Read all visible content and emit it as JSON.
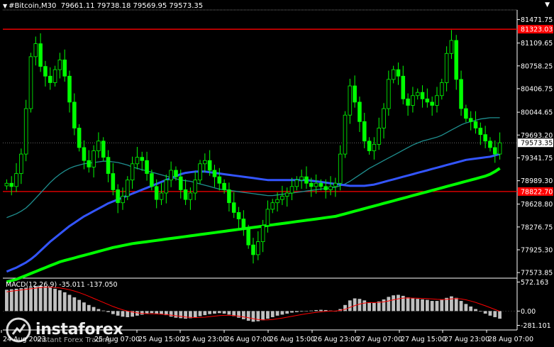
{
  "header": {
    "symbol": "#Bitcoin,M30",
    "quote": "79661.11 79738.18 79569.95 79573.35"
  },
  "indicator": {
    "label": "MACD(12,26,9) -35.011 -137.050"
  },
  "watermark": {
    "name": "instaforex",
    "sub": "Instant Forex Trading"
  },
  "colors": {
    "background": "#000000",
    "candle": "#00ff00",
    "ma_fast": "#1f8f8f",
    "ma_mid": "#3355ff",
    "ma_slow": "#00ff00",
    "level_line": "#ff0000",
    "macd_hist": "#c0c0c0",
    "macd_signal": "#ff0000"
  },
  "chart_data": {
    "type": "candlestick",
    "y_ticks": [
      "81471.75",
      "81109.65",
      "80758.25",
      "80406.75",
      "80044.65",
      "79693.20",
      "79341.75",
      "78989.30",
      "78628.80",
      "78276.75",
      "77925.30",
      "77573.85"
    ],
    "ylim": [
      77510,
      81620
    ],
    "price_labels": [
      {
        "text": "81323.03",
        "value": 81323.03,
        "type": "level",
        "color": "#ff0000"
      },
      {
        "text": "79573.35",
        "value": 79573.35,
        "type": "last",
        "color": "#ffffff"
      },
      {
        "text": "78822.70",
        "value": 78822.7,
        "type": "level",
        "color": "#ff0000"
      }
    ],
    "x_ticks": [
      "24 Aug 2023",
      "25 Aug 07:00",
      "25 Aug 15:00",
      "25 Aug 23:00",
      "26 Aug 07:00",
      "26 Aug 15:00",
      "26 Aug 23:00",
      "27 Aug 07:00",
      "27 Aug 15:00",
      "27 Aug 23:00",
      "28 Aug 07:00"
    ],
    "close": [
      78950,
      78900,
      79100,
      79400,
      80100,
      80900,
      81100,
      80750,
      80600,
      80500,
      80700,
      80850,
      80600,
      80200,
      79800,
      79500,
      79300,
      79200,
      79450,
      79600,
      79350,
      79100,
      78850,
      78650,
      78750,
      79000,
      79250,
      79350,
      79300,
      79100,
      78900,
      78700,
      78800,
      79000,
      79150,
      79050,
      78850,
      78700,
      78800,
      79000,
      79250,
      79300,
      79150,
      79050,
      78950,
      78850,
      78650,
      78500,
      78400,
      78250,
      78000,
      77850,
      78050,
      78300,
      78550,
      78650,
      78700,
      78750,
      78800,
      78900,
      79000,
      79050,
      78950,
      78900,
      78950,
      78900,
      78850,
      78900,
      78950,
      79400,
      80000,
      80450,
      80200,
      79900,
      79600,
      79450,
      79550,
      79800,
      80100,
      80550,
      80700,
      80600,
      80250,
      80150,
      80300,
      80350,
      80250,
      80200,
      80150,
      80300,
      80500,
      80950,
      81150,
      80550,
      80100,
      79950,
      79900,
      79800,
      79700,
      79600,
      79500,
      79400,
      79573.35
    ],
    "ma_fast": [
      78420,
      78450,
      78480,
      78520,
      78570,
      78640,
      78720,
      78800,
      78880,
      78960,
      79030,
      79090,
      79140,
      79180,
      79210,
      79230,
      79250,
      79260,
      79270,
      79280,
      79290,
      79290,
      79280,
      79270,
      79250,
      79230,
      79200,
      79180,
      79160,
      79140,
      79120,
      79100,
      79080,
      79060,
      79040,
      79020,
      79000,
      78990,
      78980,
      78960,
      78940,
      78920,
      78900,
      78880,
      78860,
      78850,
      78840,
      78830,
      78820,
      78810,
      78800,
      78790,
      78780,
      78770,
      78760,
      78760,
      78770,
      78780,
      78790,
      78800,
      78810,
      78820,
      78830,
      78840,
      78850,
      78860,
      78870,
      78880,
      78890,
      78910,
      78940,
      78980,
      79030,
      79080,
      79130,
      79180,
      79220,
      79260,
      79300,
      79340,
      79380,
      79420,
      79460,
      79500,
      79540,
      79570,
      79600,
      79620,
      79640,
      79660,
      79690,
      79730,
      79770,
      79810,
      79850,
      79880,
      79900,
      79920,
      79940,
      79950,
      79960,
      79960,
      79960
    ],
    "ma_mid": [
      77590,
      77620,
      77650,
      77690,
      77730,
      77780,
      77840,
      77910,
      77980,
      78050,
      78110,
      78170,
      78230,
      78290,
      78340,
      78390,
      78440,
      78480,
      78520,
      78560,
      78600,
      78640,
      78670,
      78700,
      78730,
      78760,
      78790,
      78820,
      78850,
      78880,
      78910,
      78940,
      78970,
      79000,
      79030,
      79060,
      79090,
      79110,
      79120,
      79130,
      79130,
      79130,
      79120,
      79110,
      79100,
      79090,
      79080,
      79070,
      79060,
      79050,
      79040,
      79030,
      79020,
      79010,
      79000,
      79000,
      79000,
      79000,
      79000,
      79000,
      79000,
      79000,
      79000,
      78990,
      78980,
      78970,
      78960,
      78950,
      78940,
      78930,
      78920,
      78910,
      78910,
      78910,
      78910,
      78920,
      78930,
      78950,
      78970,
      78990,
      79010,
      79030,
      79050,
      79070,
      79090,
      79110,
      79130,
      79150,
      79170,
      79190,
      79210,
      79230,
      79250,
      79270,
      79290,
      79310,
      79320,
      79330,
      79340,
      79350,
      79360,
      79380,
      79400
    ],
    "ma_slow": [
      77430,
      77450,
      77470,
      77500,
      77530,
      77560,
      77590,
      77620,
      77650,
      77680,
      77710,
      77740,
      77760,
      77780,
      77800,
      77820,
      77840,
      77860,
      77880,
      77900,
      77920,
      77940,
      77960,
      77975,
      77990,
      78005,
      78020,
      78030,
      78040,
      78050,
      78060,
      78070,
      78080,
      78090,
      78100,
      78110,
      78120,
      78130,
      78140,
      78150,
      78160,
      78170,
      78180,
      78190,
      78200,
      78210,
      78220,
      78230,
      78240,
      78250,
      78260,
      78270,
      78280,
      78290,
      78300,
      78310,
      78320,
      78330,
      78340,
      78350,
      78360,
      78370,
      78380,
      78390,
      78400,
      78410,
      78420,
      78430,
      78440,
      78460,
      78480,
      78500,
      78520,
      78540,
      78560,
      78580,
      78600,
      78620,
      78640,
      78660,
      78680,
      78700,
      78720,
      78740,
      78760,
      78780,
      78800,
      78820,
      78840,
      78860,
      78880,
      78900,
      78920,
      78940,
      78960,
      78980,
      79000,
      79020,
      79040,
      79060,
      79090,
      79130,
      79180
    ],
    "macd": {
      "y_ticks": [
        "572.163",
        "0.00",
        "-281.101"
      ],
      "ylim": [
        -330,
        620
      ],
      "hist": [
        420,
        430,
        440,
        450,
        460,
        470,
        490,
        500,
        490,
        470,
        440,
        410,
        370,
        320,
        270,
        220,
        170,
        120,
        80,
        40,
        10,
        -20,
        -60,
        -90,
        -110,
        -120,
        -110,
        -90,
        -70,
        -50,
        -40,
        -50,
        -60,
        -80,
        -110,
        -130,
        -140,
        -150,
        -140,
        -120,
        -100,
        -80,
        -60,
        -50,
        -40,
        -50,
        -70,
        -100,
        -130,
        -160,
        -190,
        -210,
        -200,
        -180,
        -150,
        -120,
        -90,
        -70,
        -50,
        -30,
        -20,
        -10,
        0,
        10,
        20,
        25,
        20,
        10,
        0,
        40,
        120,
        210,
        250,
        240,
        210,
        170,
        160,
        190,
        230,
        280,
        310,
        320,
        300,
        270,
        250,
        240,
        230,
        220,
        200,
        200,
        220,
        260,
        290,
        260,
        200,
        140,
        90,
        40,
        -10,
        -50,
        -90,
        -120,
        -150
      ],
      "signal": [
        380,
        392,
        404,
        416,
        428,
        440,
        452,
        464,
        470,
        470,
        465,
        455,
        440,
        420,
        395,
        365,
        330,
        290,
        250,
        210,
        170,
        130,
        90,
        55,
        25,
        0,
        -20,
        -35,
        -45,
        -50,
        -52,
        -55,
        -60,
        -68,
        -80,
        -92,
        -104,
        -116,
        -124,
        -128,
        -126,
        -120,
        -110,
        -100,
        -90,
        -84,
        -84,
        -90,
        -100,
        -115,
        -132,
        -150,
        -165,
        -172,
        -172,
        -165,
        -152,
        -137,
        -120,
        -102,
        -85,
        -68,
        -52,
        -38,
        -25,
        -14,
        -6,
        0,
        2,
        12,
        36,
        72,
        108,
        138,
        158,
        168,
        168,
        172,
        182,
        200,
        222,
        242,
        255,
        258,
        256,
        252,
        248,
        244,
        238,
        232,
        228,
        230,
        240,
        246,
        240,
        222,
        198,
        170,
        138,
        104,
        68,
        32,
        -5
      ]
    }
  }
}
